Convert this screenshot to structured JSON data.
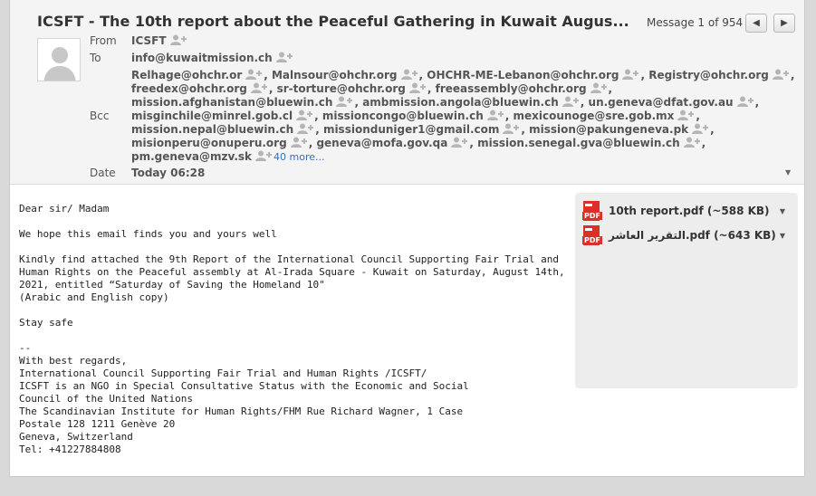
{
  "subject": "ICSFT - The 10th report about the Peaceful Gathering in Kuwait Augus...",
  "nav": {
    "message_counter": "Message 1 of 954",
    "prev_icon": "chevron-left-icon",
    "next_icon": "chevron-right-icon"
  },
  "labels": {
    "from": "From",
    "to": "To",
    "bcc": "Bcc",
    "date": "Date"
  },
  "from": "ICSFT",
  "to": "info@kuwaitmission.ch",
  "recipients": [
    [
      "Relhage@ohchr.or",
      "Malnsour@ohchr.org",
      "OHCHR-ME-Lebanon@ohchr.org",
      "Registry@ohchr.org"
    ],
    [
      "freedex@ohchr.org",
      "sr-torture@ohchr.org",
      "freeassembly@ohchr.org"
    ],
    [
      "mission.afghanistan@bluewin.ch",
      "ambmission.angola@bluewin.ch",
      "un.geneva@dfat.gov.au"
    ],
    [
      "misginchile@minrel.gob.cl",
      "missioncongo@bluewin.ch",
      "mexicounoge@sre.gob.mx"
    ],
    [
      "mission.nepal@bluewin.ch",
      "missionduniger1@gmail.com",
      "mission@pakungeneva.pk"
    ],
    [
      "misionperu@onuperu.org",
      "geneva@mofa.gov.qa",
      "mission.senegal.gva@bluewin.ch"
    ],
    [
      "pm.geneva@mzv.sk"
    ]
  ],
  "more_link": "40 more...",
  "date": "Today 06:28",
  "body_lines": [
    "Dear sir/ Madam",
    "",
    "We hope this email finds you and yours well",
    "",
    "Kindly find attached the 9th Report of the International Council Supporting Fair Trial and",
    "Human Rights on the Peaceful assembly at Al-Irada Square - Kuwait on Saturday, August 14th,",
    "2021, entitled “Saturday of Saving the Homeland 10\"",
    "(Arabic and English copy)",
    "",
    "Stay safe",
    "",
    "--",
    "With best regards,",
    "International Council Supporting Fair Trial and Human Rights /ICSFT/",
    "ICSFT is an NGO in Special Consultative Status with the Economic and Social",
    "Council of the United Nations",
    "The Scandinavian Institute for Human Rights/FHM Rue Richard Wagner, 1 Case",
    "Postale 128 1211 Genève 20",
    "Geneva, Switzerland",
    "Tel: +41227884808"
  ],
  "attachments": [
    {
      "name": "10th report.pdf (~588 KB)",
      "icon": "pdf-file-icon",
      "badge": "PDF"
    },
    {
      "name": "التقرير العاشر.pdf (~643 KB)",
      "icon": "pdf-file-icon",
      "badge": "PDF"
    }
  ],
  "colors": {
    "link": "#3a6fb4",
    "pdf_red": "#d9302a",
    "header_bg": "#f4f4f4"
  }
}
